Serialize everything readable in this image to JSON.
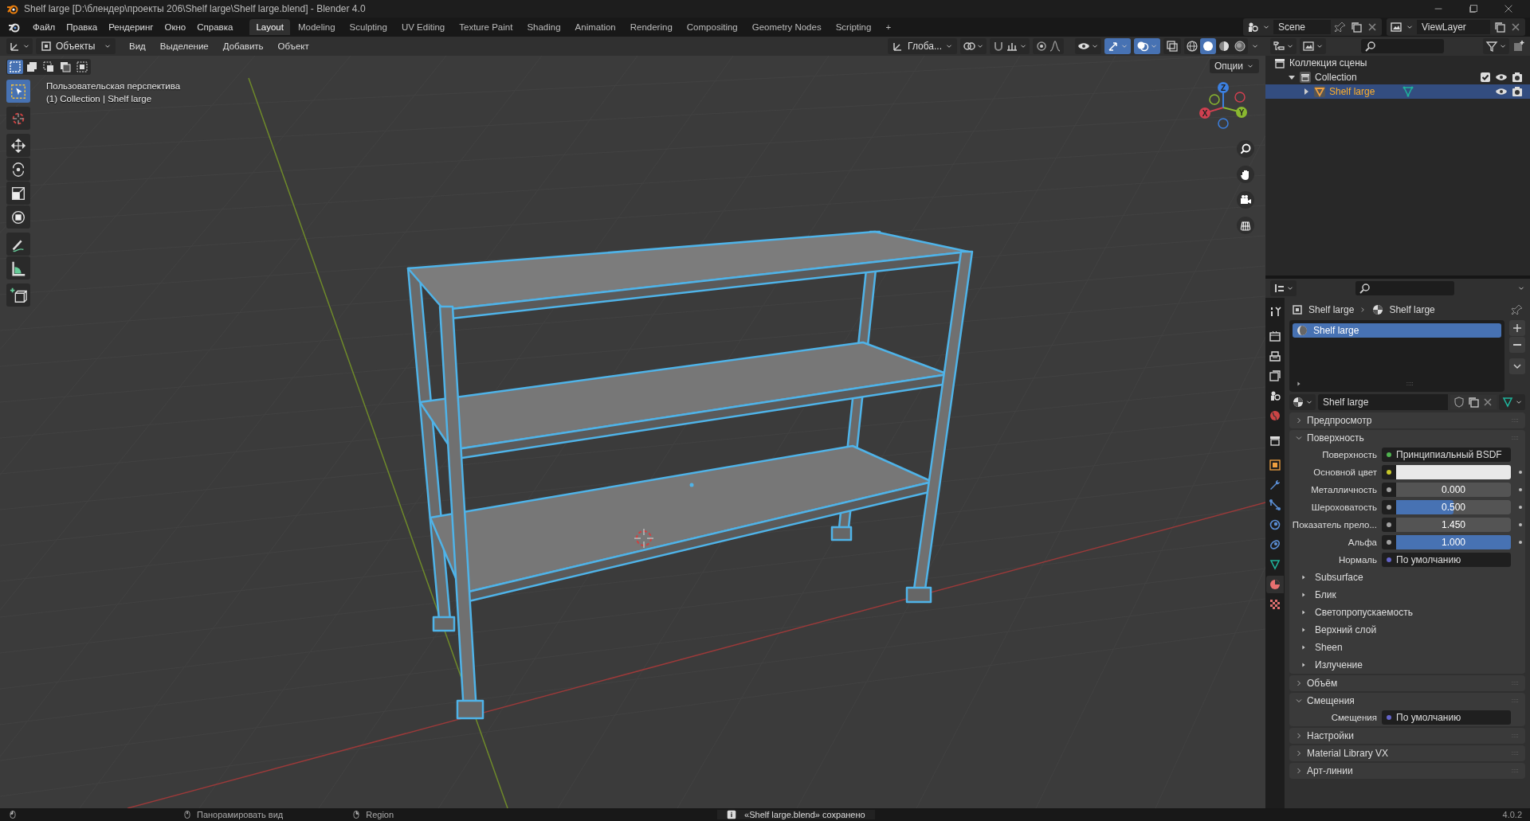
{
  "window": {
    "title": "Shelf large [D:\\блендер\\проекты 206\\Shelf large\\Shelf large.blend] - Blender 4.0"
  },
  "menu": [
    "Файл",
    "Правка",
    "Рендеринг",
    "Окно",
    "Справка"
  ],
  "workspaces": [
    {
      "label": "Layout",
      "selected": true
    },
    {
      "label": "Modeling",
      "selected": false
    },
    {
      "label": "Sculpting",
      "selected": false
    },
    {
      "label": "UV Editing",
      "selected": false
    },
    {
      "label": "Texture Paint",
      "selected": false
    },
    {
      "label": "Shading",
      "selected": false
    },
    {
      "label": "Animation",
      "selected": false
    },
    {
      "label": "Rendering",
      "selected": false
    },
    {
      "label": "Compositing",
      "selected": false
    },
    {
      "label": "Geometry Nodes",
      "selected": false
    },
    {
      "label": "Scripting",
      "selected": false
    }
  ],
  "add_workspace": "+",
  "scene": "Scene",
  "view_layer": "ViewLayer",
  "viewport_header": {
    "mode": "Объекты",
    "menus": [
      "Вид",
      "Выделение",
      "Добавить",
      "Объект"
    ],
    "orientation": "Глоба...",
    "toggles": [
      {
        "kind": "visibility",
        "on": false
      },
      {
        "kind": "gizmo",
        "on": true
      },
      {
        "kind": "overlay",
        "on": true
      },
      {
        "kind": "xray",
        "on": false
      }
    ],
    "shading": [
      {
        "kind": "wireframe",
        "selected": false
      },
      {
        "kind": "solid",
        "selected": true
      },
      {
        "kind": "material",
        "selected": false
      },
      {
        "kind": "rendered",
        "selected": false
      }
    ]
  },
  "select_modes": [
    {
      "selected": true
    },
    {
      "selected": false
    },
    {
      "selected": false
    },
    {
      "selected": false
    },
    {
      "selected": false
    }
  ],
  "options": "Опции",
  "toolbar": [
    {
      "kind": "select",
      "selected": true
    },
    {
      "kind": "cursor",
      "selected": false
    },
    {
      "kind": "move",
      "selected": false
    },
    {
      "kind": "rotate",
      "selected": false
    },
    {
      "kind": "scale",
      "selected": false
    },
    {
      "kind": "transform",
      "selected": false
    },
    {
      "kind": "annotate",
      "selected": false
    },
    {
      "kind": "measure",
      "selected": false
    },
    {
      "kind": "add_cube",
      "selected": false
    }
  ],
  "viewport": {
    "overlay_lines": [
      "Пользовательская перспектива",
      "(1) Collection | Shelf large"
    ],
    "gizmo_axes": [
      "X",
      "Y",
      "Z"
    ]
  },
  "outliner": {
    "items": [
      {
        "label": "Коллекция сцены",
        "kind": "scene_collection",
        "children": [
          {
            "label": "Collection",
            "kind": "collection",
            "expanded": true,
            "checked": true,
            "children": [
              {
                "label": "Shelf large",
                "kind": "object",
                "expanded": false,
                "selected": true
              }
            ]
          }
        ]
      }
    ]
  },
  "properties": {
    "tabs": [
      {
        "kind": "tool",
        "selected": false
      },
      {
        "kind": "render",
        "selected": false
      },
      {
        "kind": "output",
        "selected": false
      },
      {
        "kind": "view_layer",
        "selected": false
      },
      {
        "kind": "scene",
        "selected": false
      },
      {
        "kind": "world",
        "selected": false
      },
      {
        "kind": "collection",
        "selected": false
      },
      {
        "kind": "object",
        "selected": false
      },
      {
        "kind": "modifiers",
        "selected": false
      },
      {
        "kind": "particles",
        "selected": false
      },
      {
        "kind": "physics",
        "selected": false
      },
      {
        "kind": "constraints",
        "selected": false
      },
      {
        "kind": "data",
        "selected": false
      },
      {
        "kind": "material",
        "selected": true
      },
      {
        "kind": "texture",
        "selected": false
      }
    ],
    "breadcrumb": [
      "Shelf large",
      "Shelf large"
    ],
    "material_slots": [
      {
        "label": "Shelf large",
        "selected": true
      }
    ],
    "material_name": "Shelf large",
    "panels": [
      {
        "title": "Предпросмотр",
        "expanded": false
      },
      {
        "title": "Поверхность",
        "expanded": true,
        "fields": [
          {
            "kind": "link",
            "label": "Поверхность",
            "value": "Принципиальный BSDF",
            "color": "#4fb24f"
          },
          {
            "kind": "color",
            "label": "Основной цвет",
            "color": "#e8e8e8"
          },
          {
            "kind": "slider",
            "label": "Металличность",
            "value": "0.000",
            "level": 0,
            "color": "#a1a1a1"
          },
          {
            "kind": "slider",
            "label": "Шероховатость",
            "value": "0.500",
            "level": 0.5,
            "color": "#a1a1a1"
          },
          {
            "kind": "number",
            "label": "Показатель прело...",
            "value": "1.450",
            "color": "#a1a1a1"
          },
          {
            "kind": "slider",
            "label": "Альфа",
            "value": "1.000",
            "level": 1,
            "color": "#a1a1a1"
          },
          {
            "kind": "link",
            "label": "Нормаль",
            "value": "По умолчанию",
            "color": "#6363c7"
          }
        ],
        "subpanels": [
          {
            "label": "Subsurface",
            "expanded": false
          },
          {
            "label": "Блик",
            "expanded": false
          },
          {
            "label": "Светопропускаемость",
            "expanded": false
          },
          {
            "label": "Верхний слой",
            "expanded": false
          },
          {
            "label": "Sheen",
            "expanded": false
          },
          {
            "label": "Излучение",
            "expanded": false
          }
        ]
      },
      {
        "title": "Объём",
        "expanded": false
      },
      {
        "title": "Смещения",
        "expanded": true,
        "fields": [
          {
            "kind": "link",
            "label": "Смещения",
            "value": "По умолчанию",
            "color": "#6363c7"
          }
        ]
      },
      {
        "title": "Настройки",
        "expanded": false
      },
      {
        "title": "Material Library VX",
        "expanded": false
      },
      {
        "title": "Арт-линии",
        "expanded": false
      }
    ]
  },
  "status_bar": {
    "hints": [
      "Панорамировать вид",
      "Region"
    ],
    "message": "«Shelf large.blend» сохранено",
    "version": "4.0.2"
  }
}
